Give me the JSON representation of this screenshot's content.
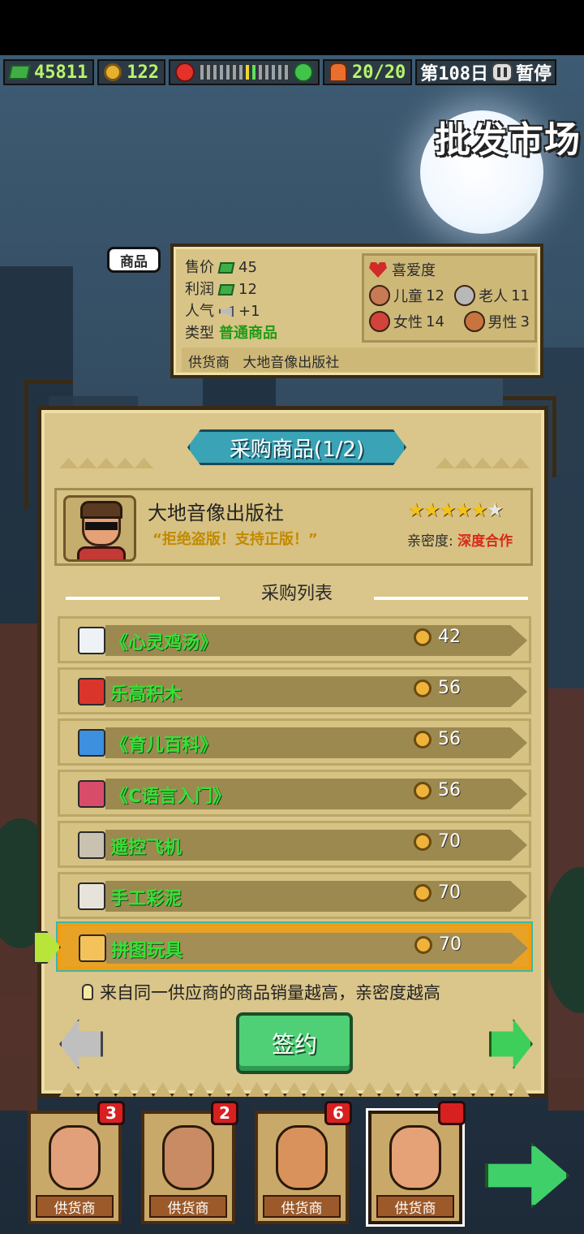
{
  "hud": {
    "money": "45811",
    "coins": "122",
    "staff": "20/20",
    "day": "第108日",
    "pause_label": "暂停",
    "mood_level_fraction": 0.58
  },
  "location": {
    "title": "批发市场"
  },
  "product_info": {
    "tag": "商品",
    "price_label": "售价",
    "price_value": "45",
    "profit_label": "利润",
    "profit_value": "12",
    "popularity_label": "人气",
    "popularity_value": "+1",
    "type_label": "类型",
    "type_value": "普通商品",
    "supplier_label": "供货商",
    "supplier_value": "大地音像出版社",
    "preference": {
      "title": "喜爱度",
      "kids_label": "儿童",
      "kids_value": "12",
      "elderly_label": "老人",
      "elderly_value": "11",
      "female_label": "女性",
      "female_value": "14",
      "male_label": "男性",
      "male_value": "3"
    }
  },
  "panel": {
    "title": "采购商品(1/2)",
    "supplier_name": "大地音像出版社",
    "supplier_slogan": "“拒绝盗版！支持正版！”",
    "stars_filled": 5,
    "stars_total": 6,
    "closeness_label": "亲密度:",
    "closeness_value": "深度合作",
    "list_title": "采购列表",
    "hint": "来自同一供应商的商品销量越高，亲密度越高",
    "sign_label": "签约"
  },
  "items": [
    {
      "name": "《心灵鸡汤》",
      "price": "42",
      "icon": "book-icon",
      "color": "#eef2f7",
      "selected": false
    },
    {
      "name": "乐高积木",
      "price": "56",
      "icon": "lego-icon",
      "color": "#d9352a",
      "selected": false
    },
    {
      "name": "《育儿百科》",
      "price": "56",
      "icon": "book-icon",
      "color": "#3d8fe0",
      "selected": false
    },
    {
      "name": "《C语言入门》",
      "price": "56",
      "icon": "book-icon",
      "color": "#d84c6a",
      "selected": false
    },
    {
      "name": "遥控飞机",
      "price": "70",
      "icon": "plane-icon",
      "color": "#c9c2b0",
      "selected": false
    },
    {
      "name": "手工彩泥",
      "price": "70",
      "icon": "clay-icon",
      "color": "#e8e3da",
      "selected": false
    },
    {
      "name": "拼图玩具",
      "price": "70",
      "icon": "puzzle-icon",
      "color": "#f3c25a",
      "selected": true
    }
  ],
  "suppliers": [
    {
      "label": "供货商",
      "badge": "3",
      "color": "#e1a07a"
    },
    {
      "label": "供货商",
      "badge": "2",
      "color": "#c88b64"
    },
    {
      "label": "供货商",
      "badge": "6",
      "color": "#d9925c"
    },
    {
      "label": "供货商",
      "badge": "",
      "color": "#e5a277"
    }
  ],
  "colors": {
    "accent_green": "#36e236",
    "closeness_red": "#d82a1a",
    "selection_orange": "#f39c12"
  }
}
